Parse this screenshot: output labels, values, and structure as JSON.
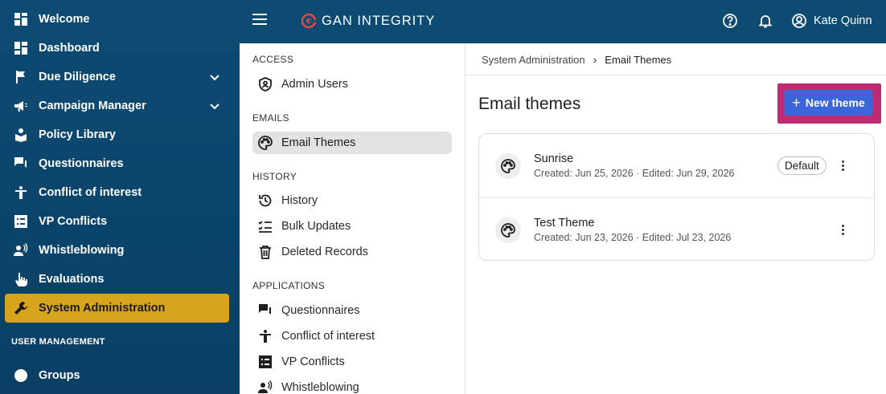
{
  "sidebar": {
    "items": [
      {
        "label": "Welcome",
        "icon": "grid-icon"
      },
      {
        "label": "Dashboard",
        "icon": "dashboard-icon"
      },
      {
        "label": "Due Diligence",
        "icon": "flag-icon"
      },
      {
        "label": "Campaign Manager",
        "icon": "megaphone-icon"
      },
      {
        "label": "Policy Library",
        "icon": "library-icon"
      },
      {
        "label": "Questionnaires",
        "icon": "chat-icon"
      },
      {
        "label": "Conflict of interest",
        "icon": "person-icon"
      },
      {
        "label": "VP Conflicts",
        "icon": "list-icon"
      },
      {
        "label": "Whistleblowing",
        "icon": "voice-icon"
      },
      {
        "label": "Evaluations",
        "icon": "touch-icon"
      },
      {
        "label": "System Administration",
        "icon": "wrench-icon"
      },
      {
        "label": "Groups",
        "icon": "groups-icon"
      }
    ],
    "section_label": "USER MANAGEMENT",
    "active_color": "#d7a51d"
  },
  "topbar": {
    "brand": "GAN INTEGRITY",
    "user": "Kate Quinn"
  },
  "subnav": {
    "sections": [
      {
        "heading": "ACCESS",
        "items": [
          "Admin Users"
        ]
      },
      {
        "heading": "EMAILS",
        "items": [
          "Email Themes"
        ]
      },
      {
        "heading": "HISTORY",
        "items": [
          "History",
          "Bulk Updates",
          "Deleted Records"
        ]
      },
      {
        "heading": "APPLICATIONS",
        "items": [
          "Questionnaires",
          "Conflict of interest",
          "VP Conflicts",
          "Whistleblowing"
        ]
      }
    ],
    "selected": "Email Themes"
  },
  "main": {
    "breadcrumb": [
      "System Administration",
      "Email Themes"
    ],
    "breadcrumb_sep": "›",
    "title": "Email themes",
    "new_button": "New theme",
    "new_button_icon": "+",
    "themes": [
      {
        "name": "Sunrise",
        "meta": "Created: Jun 25, 2026 · Edited: Jun 29, 2026",
        "badge": "Default"
      },
      {
        "name": "Test Theme",
        "meta": "Created: Jun 23, 2026 · Edited: Jul 23, 2026",
        "badge": ""
      }
    ]
  }
}
